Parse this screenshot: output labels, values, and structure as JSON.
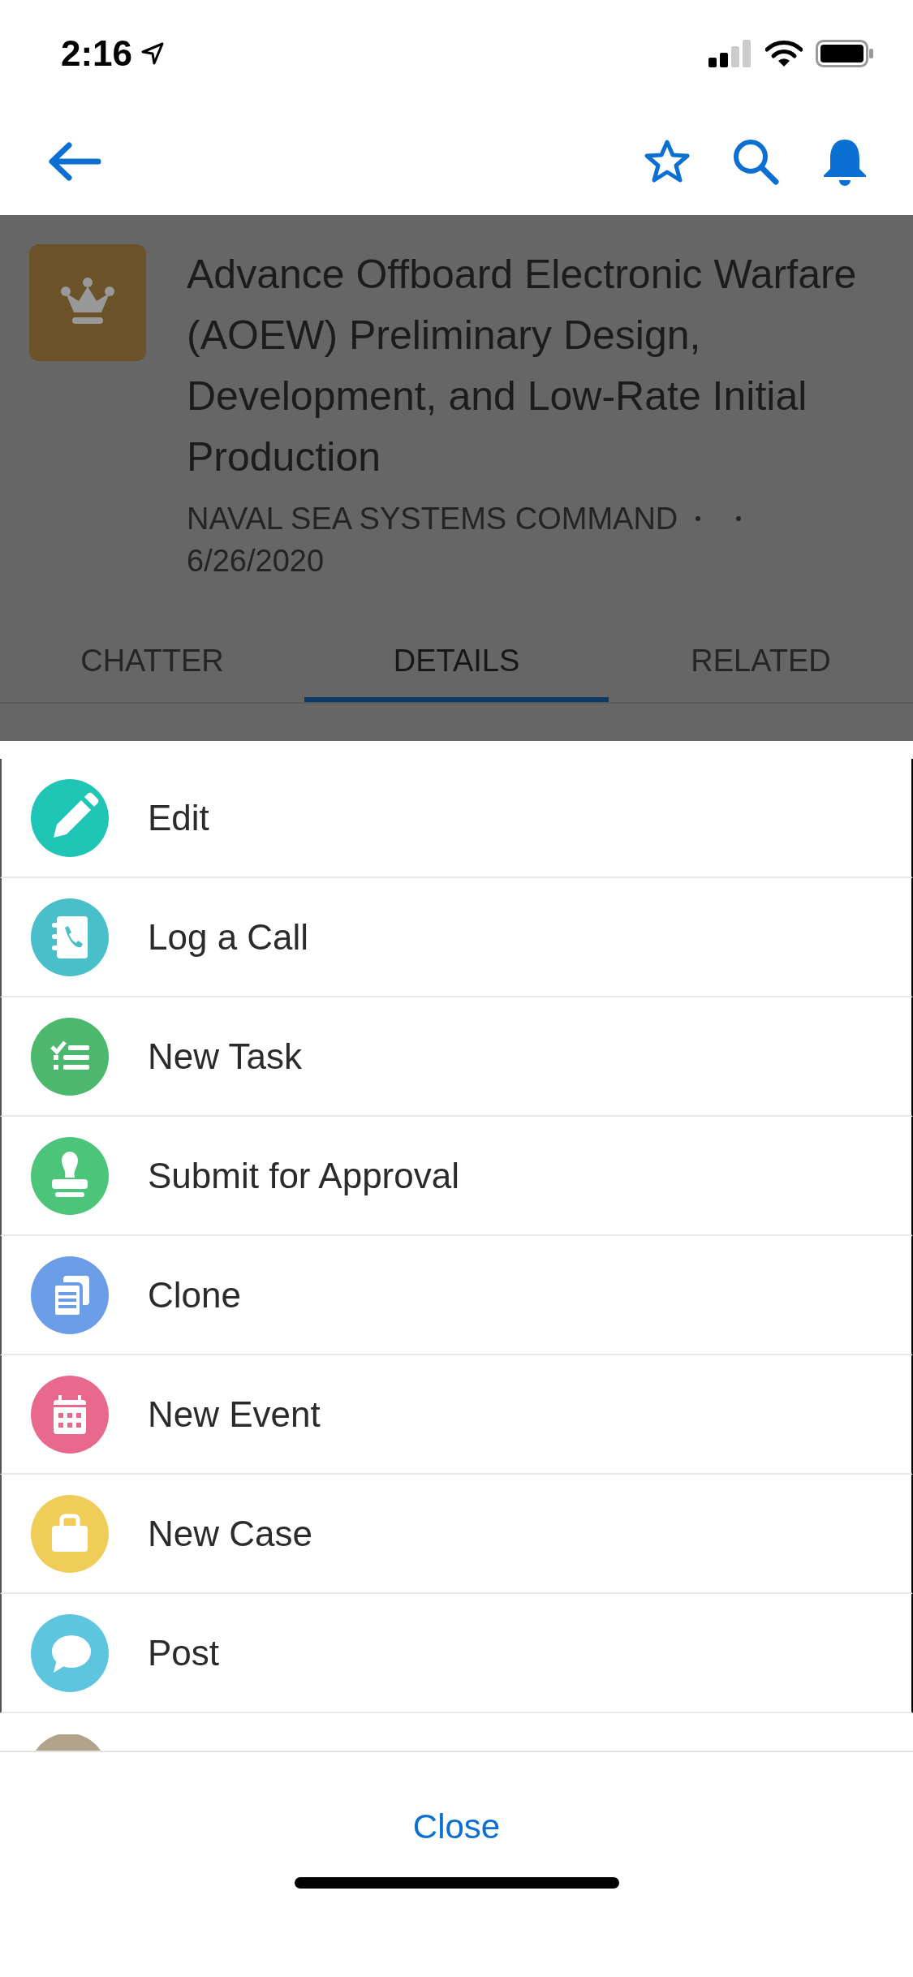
{
  "status_bar": {
    "time": "2:16"
  },
  "record": {
    "title": "Advance Offboard Electronic Warfare (AOEW) Preliminary Design, Development, and Low-Rate Initial Production",
    "meta_fields": [
      "NAVAL SEA SYSTEMS COMMAND",
      "6/26/2020"
    ]
  },
  "tabs": [
    {
      "label": "CHATTER",
      "selected": false
    },
    {
      "label": "DETAILS",
      "selected": true
    },
    {
      "label": "RELATED",
      "selected": false
    }
  ],
  "actions": [
    {
      "kind": "edit",
      "label": "Edit",
      "color": "#1fc6b5"
    },
    {
      "kind": "log-call",
      "label": "Log a Call",
      "color": "#48bfc9"
    },
    {
      "kind": "task",
      "label": "New Task",
      "color": "#4bb86e"
    },
    {
      "kind": "approval",
      "label": "Submit for Approval",
      "color": "#4cc479"
    },
    {
      "kind": "clone",
      "label": "Clone",
      "color": "#6b9ee6"
    },
    {
      "kind": "event",
      "label": "New Event",
      "color": "#e9698d"
    },
    {
      "kind": "case",
      "label": "New Case",
      "color": "#f0cc58"
    },
    {
      "kind": "post",
      "label": "Post",
      "color": "#5ec5df"
    },
    {
      "kind": "partial",
      "color": "#b1a48a"
    }
  ],
  "close_button": "Close"
}
